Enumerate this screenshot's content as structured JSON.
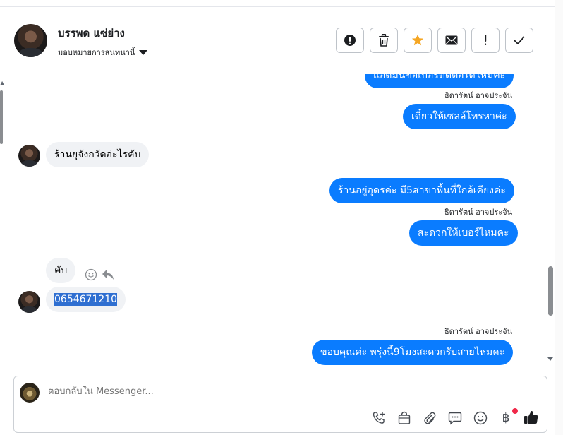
{
  "header": {
    "contact_name": "บรรพด แซ่ย่าง",
    "assign_label": "มอบหมายการสนทนานี้",
    "toolbar": [
      {
        "name": "spam-button",
        "icon": "alert-circle-icon"
      },
      {
        "name": "delete-button",
        "icon": "trash-icon"
      },
      {
        "name": "star-button",
        "icon": "star-icon"
      },
      {
        "name": "mark-unread-button",
        "icon": "envelope-icon"
      },
      {
        "name": "follow-up-button",
        "icon": "exclamation-icon"
      },
      {
        "name": "mark-done-button",
        "icon": "check-icon"
      }
    ]
  },
  "messages": {
    "m0_partial": "แอดมินขอเบอร์ติดต่อได้ไหมคะ",
    "m1_sender": "ธิดารัตน์ อาจประจัน",
    "m1_text": "เดี๋ยวให้เซลล์โทรหาค่ะ",
    "m2_text": "ร้านยุจังกวัดอ่ะไรคับ",
    "m3_text": "ร้านอยู่อุดรค่ะ มี5สาขาพื้นที่ใกล้เคียงค่ะ",
    "m4_sender": "ธิดารัตน์ อาจประจัน",
    "m4_text": "สะดวกให้เบอร์ไหมคะ",
    "m5_text": "คับ",
    "m6_text": "0654671210",
    "m7_sender": "ธิดารัตน์ อาจประจัน",
    "m7_text": "ขอบคุณค่ะ พรุ่งนี้9โมงสะดวกรับสายไหมคะ"
  },
  "composer": {
    "placeholder": "ตอบกลับใน Messenger...",
    "baht_symbol": "฿"
  },
  "colors": {
    "outgoing_bubble": "#0a7cff",
    "incoming_bubble": "#f0f2f5",
    "star": "#f5a623",
    "notification_dot": "#f02849"
  }
}
